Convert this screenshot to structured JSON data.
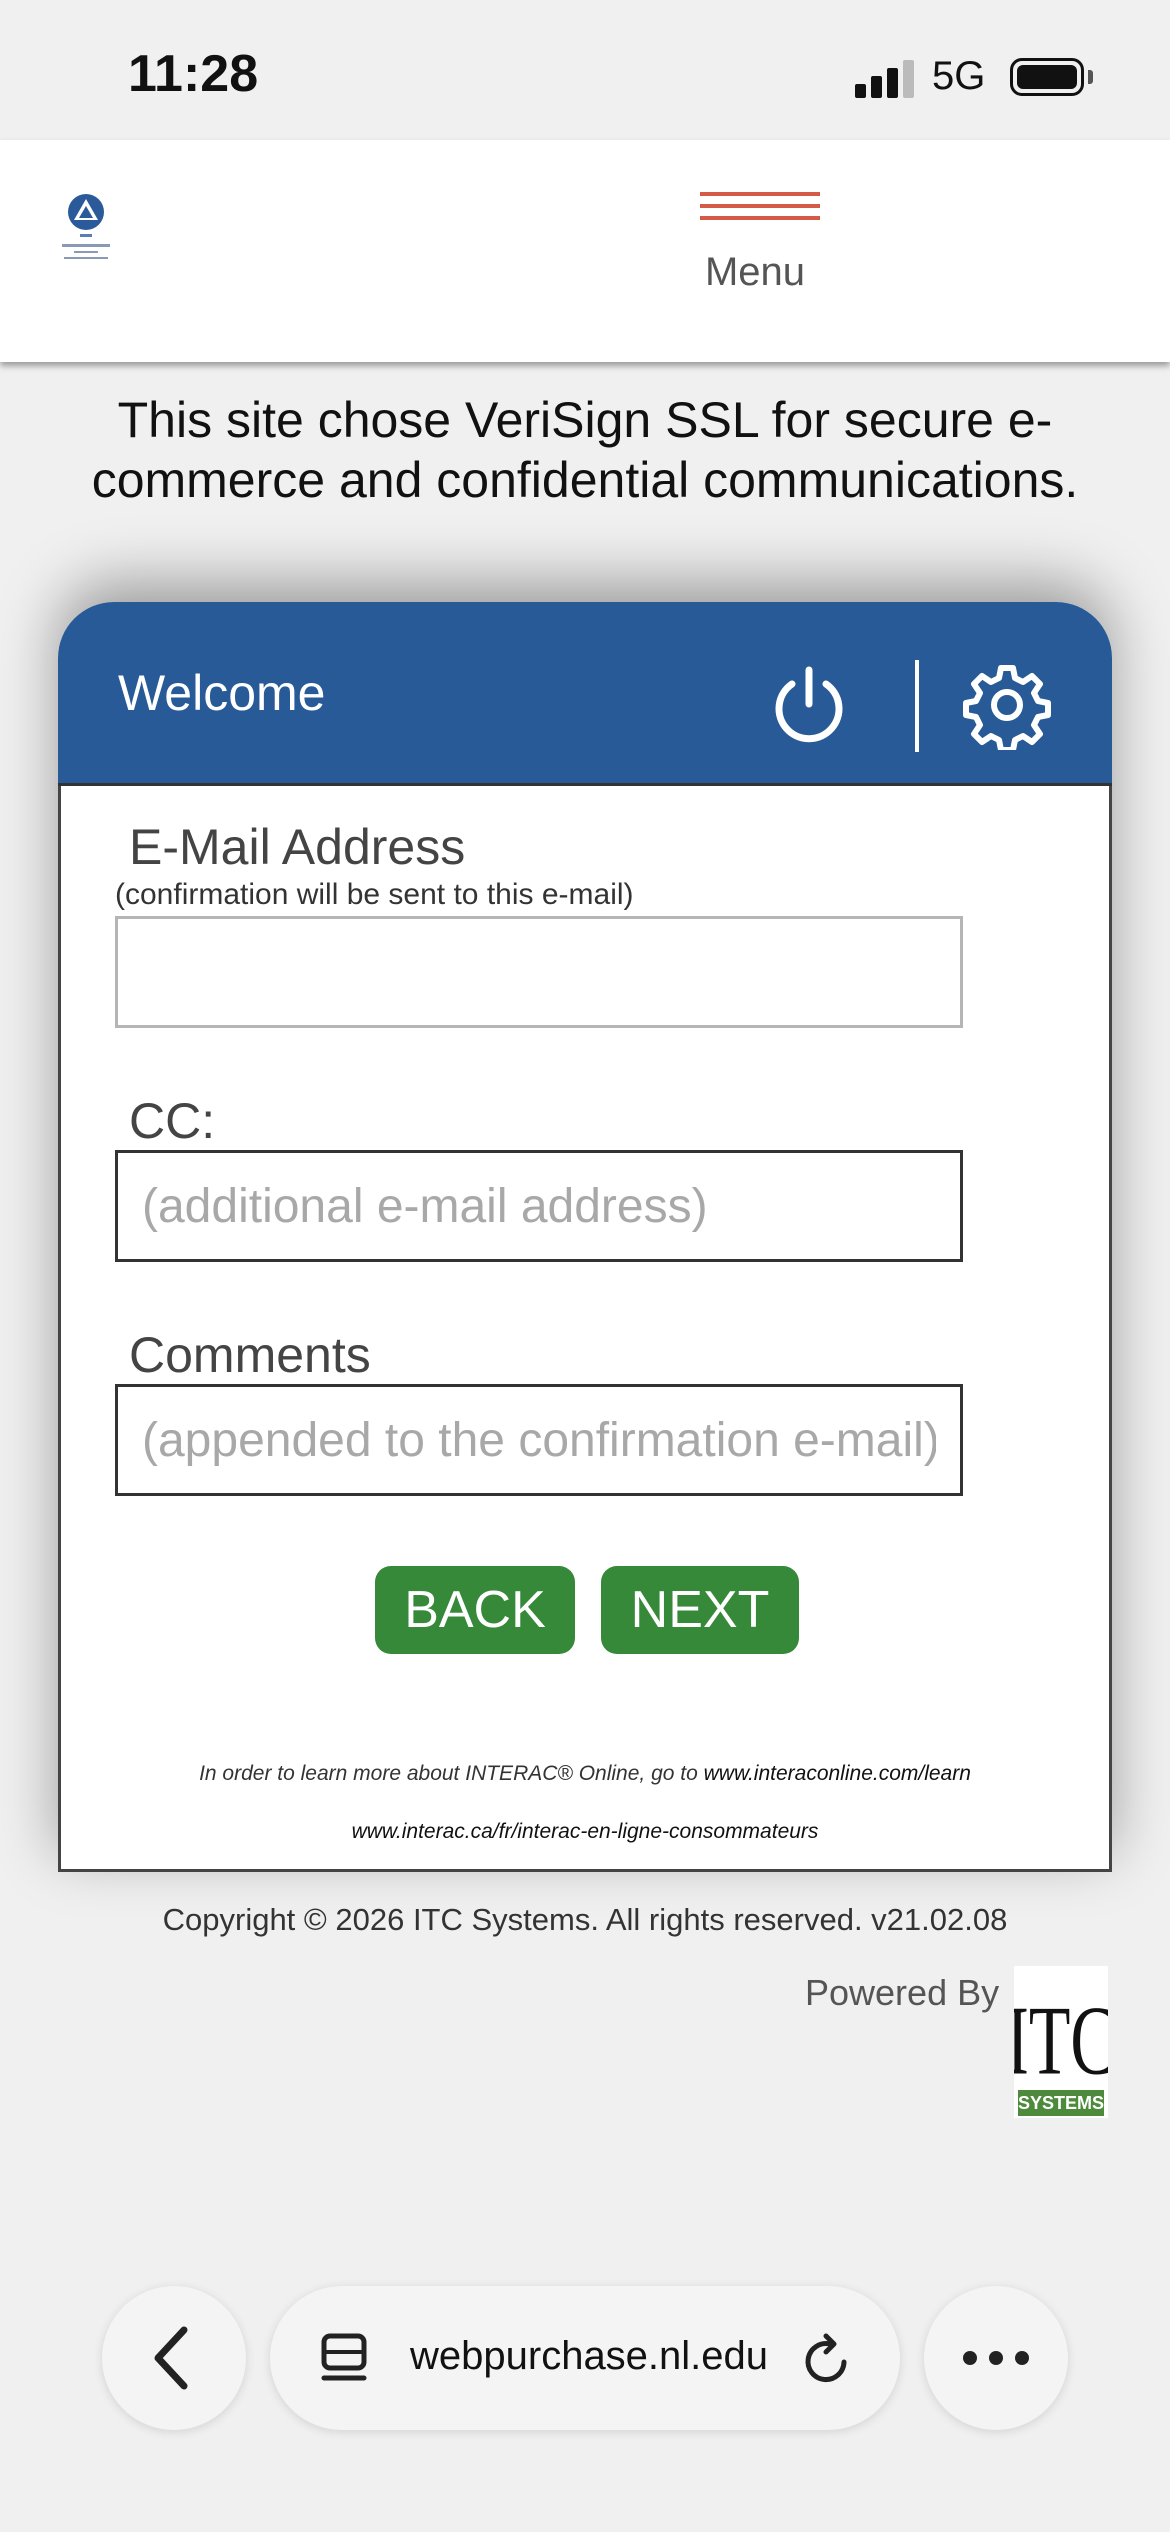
{
  "status_bar": {
    "time": "11:28",
    "network": "5G"
  },
  "header": {
    "logo_icon": "national-louis-university-logo",
    "menu_label": "Menu",
    "menu_color": "#d65a48"
  },
  "notice": {
    "text": "This site chose VeriSign SSL for secure e-commerce and confidential communications."
  },
  "card": {
    "title": "Welcome",
    "header_color": "#275a96",
    "email": {
      "label": "E-Mail Address",
      "sublabel": "(confirmation will be sent to this e-mail)",
      "value": "",
      "placeholder": ""
    },
    "cc": {
      "label": "CC:",
      "placeholder": "(additional e-mail address)"
    },
    "comments": {
      "label": "Comments",
      "placeholder": "(appended to the confirmation e-mail)"
    },
    "back_label": "BACK",
    "next_label": "NEXT",
    "button_color": "#37893a",
    "interac_prefix": "In order to learn more about INTERAC® Online, go to ",
    "interac_link_en": "www.interaconline.com/learn",
    "interac_link_fr": "www.interac.ca/fr/interac-en-ligne-consommateurs"
  },
  "footer": {
    "copyright": "Copyright © 2026 ITC Systems. All rights reserved. v21.02.08",
    "powered_by": "Powered By",
    "itc_logo_text": "ITC",
    "itc_logo_sub": "SYSTEMS"
  },
  "browser": {
    "url": "webpurchase.nl.edu"
  }
}
